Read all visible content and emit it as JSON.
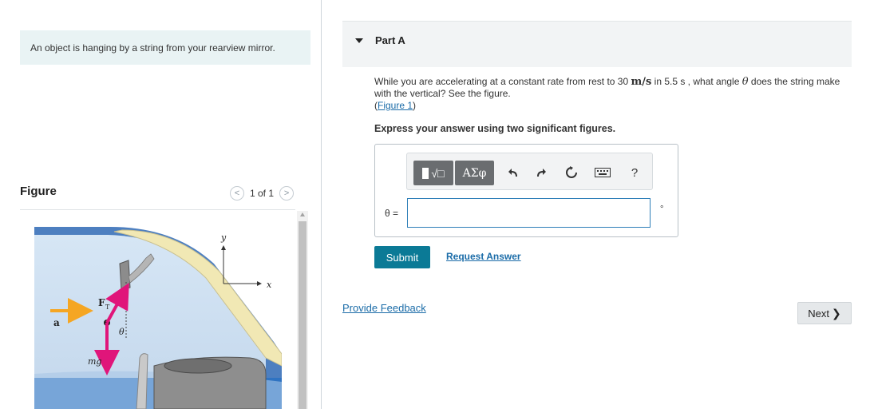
{
  "intro": {
    "text": "An object is hanging by a string from your rearview mirror."
  },
  "figure": {
    "title": "Figure",
    "pager": {
      "text": "1 of 1",
      "prev": "<",
      "next": ">"
    },
    "labels": {
      "y": "y",
      "x": "x",
      "a": "a",
      "ft": "F",
      "ft_sub": "T",
      "theta": "θ",
      "mg": "mg"
    }
  },
  "part": {
    "title": "Part A"
  },
  "question": {
    "before": "While you are accelerating at a constant rate from rest to 30 ",
    "unit1": "m/s",
    "mid": " in 5.5 s , what angle ",
    "theta": "θ",
    "after": " does the string make with the vertical? See the figure.",
    "figure_link": "Figure 1",
    "instruction": "Express your answer using two significant figures."
  },
  "answer": {
    "variable": "θ =",
    "value": "",
    "unit": "°",
    "toolbar": {
      "templates": "√□",
      "greek": "ΑΣφ",
      "help": "?"
    }
  },
  "actions": {
    "submit": "Submit",
    "request_answer": "Request Answer",
    "provide_feedback": "Provide Feedback",
    "next": "Next",
    "next_chevron": "❯"
  },
  "colors": {
    "accent": "#0b7a96",
    "link": "#1b6ca8",
    "vector": "#e0157a",
    "accel": "#f5a623"
  }
}
